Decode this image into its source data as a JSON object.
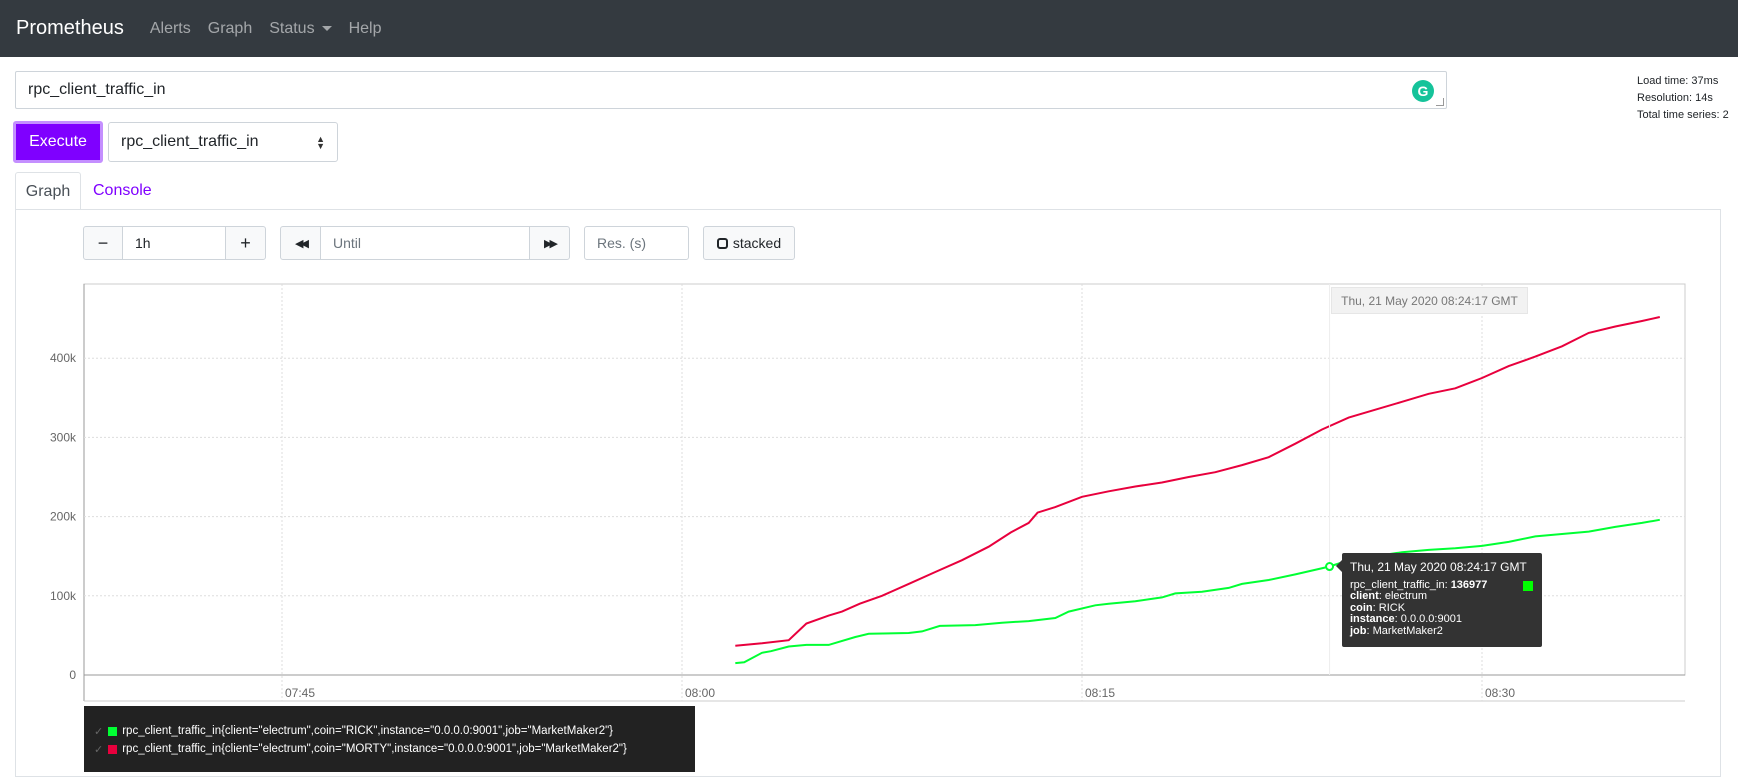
{
  "navbar": {
    "brand": "Prometheus",
    "items": [
      {
        "label": "Alerts"
      },
      {
        "label": "Graph"
      },
      {
        "label": "Status"
      },
      {
        "label": "Help"
      }
    ]
  },
  "query": {
    "expression": "rpc_client_traffic_in",
    "grammarly_icon": "G"
  },
  "stats": {
    "load_time": "Load time: 37ms",
    "resolution": "Resolution: 14s",
    "total_series": "Total time series: 2"
  },
  "execute_label": "Execute",
  "metric_select": {
    "selected": "rpc_client_traffic_in"
  },
  "tabs": {
    "graph": "Graph",
    "console": "Console"
  },
  "controls": {
    "range_minus": "−",
    "range_value": "1h",
    "range_plus": "+",
    "back_icon": "◀◀",
    "until_placeholder": "Until",
    "forward_icon": "▶▶",
    "res_placeholder": "Res. (s)",
    "stacked_label": "stacked"
  },
  "chart_data": {
    "type": "line",
    "x_ticks": [
      "07:45",
      "08:00",
      "08:15",
      "08:30"
    ],
    "y_ticks": [
      "0",
      "100k",
      "200k",
      "300k",
      "400k"
    ],
    "ylim": [
      0,
      480000
    ],
    "grid": true,
    "series": [
      {
        "name": "rpc_client_traffic_in{client=\"electrum\",coin=\"RICK\",instance=\"0.0.0.0:9001\",job=\"MarketMaker2\"}",
        "color": "#00ff33",
        "points": [
          [
            "08:02:00",
            15000
          ],
          [
            "08:02:20",
            16000
          ],
          [
            "08:03:00",
            28000
          ],
          [
            "08:03:20",
            30000
          ],
          [
            "08:04:00",
            36000
          ],
          [
            "08:04:40",
            38000
          ],
          [
            "08:05:30",
            38000
          ],
          [
            "08:06:30",
            48000
          ],
          [
            "08:07:00",
            52000
          ],
          [
            "08:08:30",
            53000
          ],
          [
            "08:09:00",
            55000
          ],
          [
            "08:09:40",
            62000
          ],
          [
            "08:11:00",
            63000
          ],
          [
            "08:12:00",
            66000
          ],
          [
            "08:13:00",
            68000
          ],
          [
            "08:14:00",
            72000
          ],
          [
            "08:14:30",
            80000
          ],
          [
            "08:15:30",
            88000
          ],
          [
            "08:16:00",
            90000
          ],
          [
            "08:17:00",
            93000
          ],
          [
            "08:18:00",
            98000
          ],
          [
            "08:18:30",
            103000
          ],
          [
            "08:19:30",
            105000
          ],
          [
            "08:20:30",
            110000
          ],
          [
            "08:21:00",
            115000
          ],
          [
            "08:22:00",
            120000
          ],
          [
            "08:23:00",
            127000
          ],
          [
            "08:24:17",
            136977
          ],
          [
            "08:25:00",
            145000
          ],
          [
            "08:26:00",
            150000
          ],
          [
            "08:27:00",
            155000
          ],
          [
            "08:28:00",
            158000
          ],
          [
            "08:29:00",
            160000
          ],
          [
            "08:30:00",
            163000
          ],
          [
            "08:31:00",
            168000
          ],
          [
            "08:32:00",
            175000
          ],
          [
            "08:33:00",
            178000
          ],
          [
            "08:34:00",
            181000
          ],
          [
            "08:35:00",
            187000
          ],
          [
            "08:36:00",
            192000
          ],
          [
            "08:36:40",
            196000
          ]
        ]
      },
      {
        "name": "rpc_client_traffic_in{client=\"electrum\",coin=\"MORTY\",instance=\"0.0.0.0:9001\",job=\"MarketMaker2\"}",
        "color": "#e8003d",
        "points": [
          [
            "08:02:00",
            37000
          ],
          [
            "08:03:00",
            40000
          ],
          [
            "08:04:00",
            44000
          ],
          [
            "08:04:40",
            65000
          ],
          [
            "08:05:30",
            75000
          ],
          [
            "08:06:00",
            80000
          ],
          [
            "08:06:40",
            90000
          ],
          [
            "08:07:30",
            100000
          ],
          [
            "08:08:30",
            115000
          ],
          [
            "08:09:30",
            130000
          ],
          [
            "08:10:30",
            145000
          ],
          [
            "08:11:30",
            162000
          ],
          [
            "08:12:20",
            180000
          ],
          [
            "08:13:00",
            192000
          ],
          [
            "08:13:20",
            205000
          ],
          [
            "08:14:00",
            212000
          ],
          [
            "08:15:00",
            225000
          ],
          [
            "08:16:00",
            232000
          ],
          [
            "08:17:00",
            238000
          ],
          [
            "08:18:00",
            243000
          ],
          [
            "08:19:00",
            250000
          ],
          [
            "08:20:00",
            256000
          ],
          [
            "08:21:00",
            265000
          ],
          [
            "08:22:00",
            275000
          ],
          [
            "08:23:00",
            292000
          ],
          [
            "08:24:00",
            310000
          ],
          [
            "08:25:00",
            325000
          ],
          [
            "08:26:00",
            335000
          ],
          [
            "08:27:00",
            345000
          ],
          [
            "08:28:00",
            355000
          ],
          [
            "08:29:00",
            362000
          ],
          [
            "08:30:00",
            375000
          ],
          [
            "08:31:00",
            390000
          ],
          [
            "08:32:00",
            402000
          ],
          [
            "08:33:00",
            415000
          ],
          [
            "08:34:00",
            432000
          ],
          [
            "08:35:00",
            440000
          ],
          [
            "08:36:00",
            447000
          ],
          [
            "08:36:40",
            452000
          ]
        ]
      }
    ],
    "hover": {
      "time_label": "Thu, 21 May 2020 08:24:17 GMT",
      "tooltip_title": "Thu, 21 May 2020 08:24:17 GMT",
      "metric": "rpc_client_traffic_in:",
      "value": "136977",
      "labels": [
        {
          "key": "client",
          "value": "electrum"
        },
        {
          "key": "coin",
          "value": "RICK"
        },
        {
          "key": "instance",
          "value": "0.0.0.0:9001"
        },
        {
          "key": "job",
          "value": "MarketMaker2"
        }
      ]
    }
  },
  "legend": {
    "check_icon": "✓",
    "items": [
      {
        "label": "rpc_client_traffic_in{client=\"electrum\",coin=\"RICK\",instance=\"0.0.0.0:9001\",job=\"MarketMaker2\"}",
        "color": "#00ff33"
      },
      {
        "label": "rpc_client_traffic_in{client=\"electrum\",coin=\"MORTY\",instance=\"0.0.0.0:9001\",job=\"MarketMaker2\"}",
        "color": "#e8003d"
      }
    ]
  }
}
